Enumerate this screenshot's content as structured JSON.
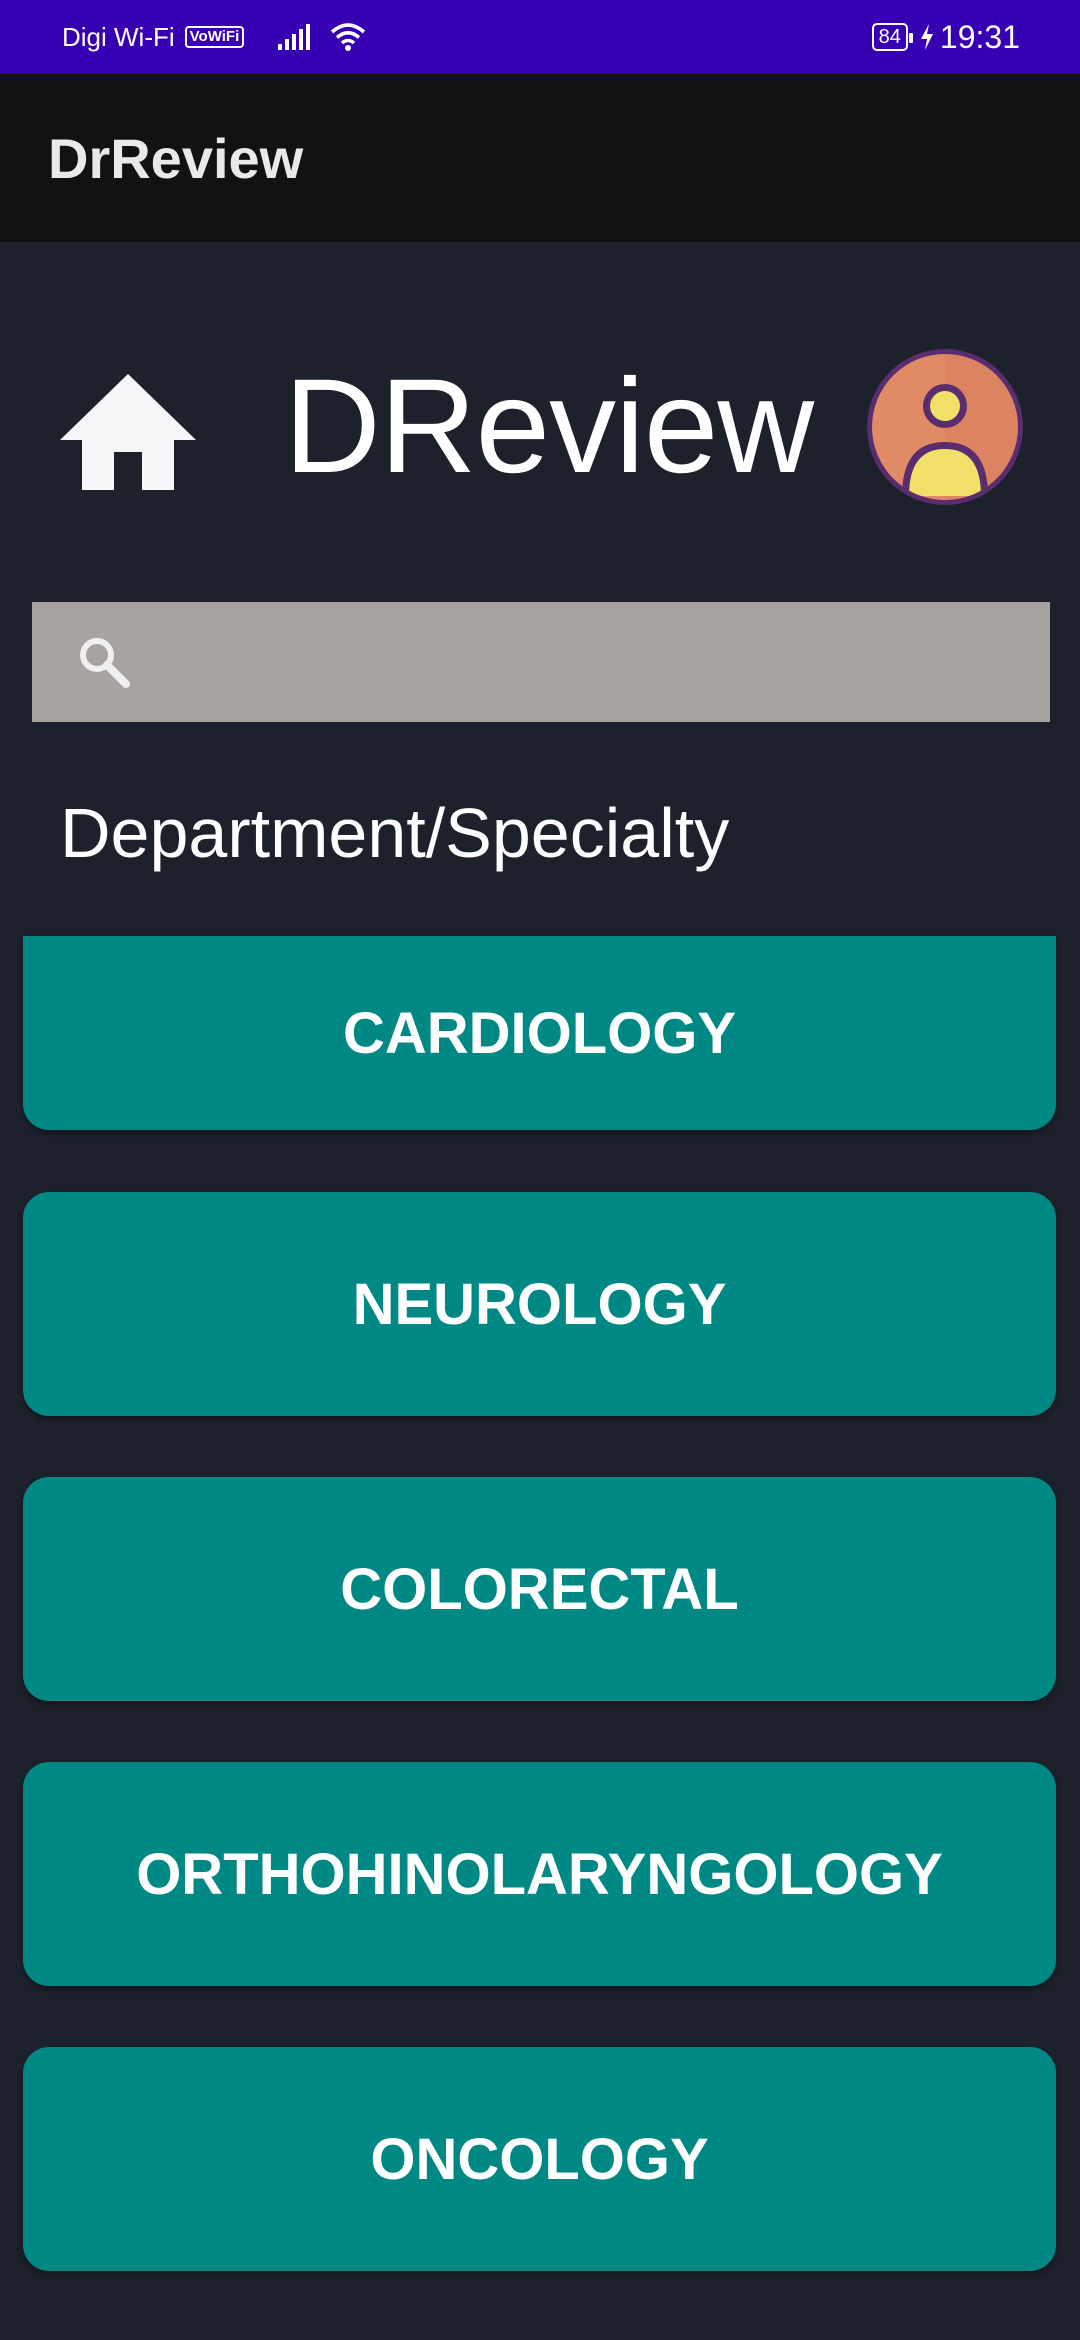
{
  "status_bar": {
    "carrier": "Digi Wi-Fi",
    "volte_label": "VoWiFi",
    "battery": "84",
    "time": "19:31"
  },
  "app_bar": {
    "title": "DrReview"
  },
  "header": {
    "title": "DReview",
    "home_icon": "home-icon",
    "avatar_icon": "user-avatar-icon"
  },
  "search": {
    "placeholder": "",
    "value": "",
    "icon": "search-icon"
  },
  "section": {
    "heading": "Department/Specialty"
  },
  "departments": [
    {
      "label": "CARDIOLOGY"
    },
    {
      "label": "NEUROLOGY"
    },
    {
      "label": "COLORECTAL"
    },
    {
      "label": "ORTHOHINOLARYNGOLOGY"
    },
    {
      "label": "ONCOLOGY"
    }
  ],
  "colors": {
    "status_bar": "#3700b3",
    "app_bar": "#121212",
    "background": "#1c212b",
    "search_bg": "#a8a3a0",
    "button": "#008885",
    "avatar_ring": "#5a2d6e",
    "avatar_fill": "#e08a66",
    "avatar_person": "#f0e06a"
  }
}
